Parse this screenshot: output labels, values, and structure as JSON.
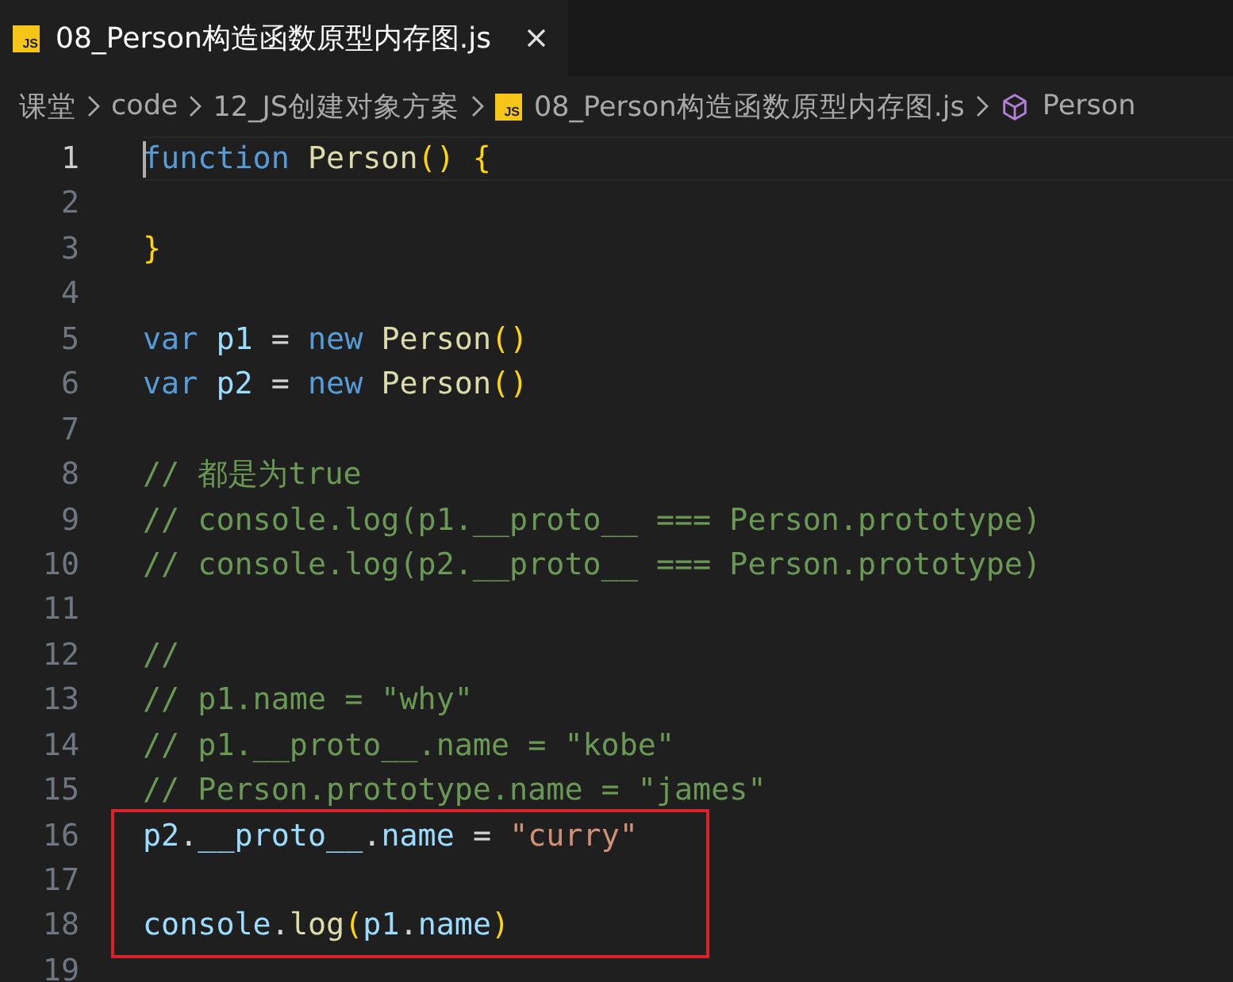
{
  "tabs": [
    {
      "label": "08_Person构造函数原型内存图.js",
      "icon_text": "JS",
      "selected": true
    }
  ],
  "breadcrumbs": [
    {
      "label": "课堂",
      "kind": "folder"
    },
    {
      "label": "code",
      "kind": "folder"
    },
    {
      "label": "12_JS创建对象方案",
      "kind": "folder"
    },
    {
      "label": "08_Person构造函数原型内存图.js",
      "kind": "file",
      "icon_text": "JS"
    },
    {
      "label": "Person",
      "kind": "symbol"
    }
  ],
  "lines": [
    {
      "number": "1",
      "current": true,
      "highlighted": false,
      "tokens": [
        {
          "text": "function ",
          "kind": "keyword"
        },
        {
          "text": "Person",
          "kind": "function"
        },
        {
          "text": "() {",
          "kind": "bracket"
        }
      ]
    },
    {
      "number": "2",
      "current": false,
      "highlighted": false
    },
    {
      "number": "3",
      "current": false,
      "highlighted": false,
      "tokens": [
        {
          "text": "}",
          "kind": "bracket"
        }
      ]
    },
    {
      "number": "4",
      "current": false,
      "highlighted": false
    },
    {
      "number": "5",
      "current": false,
      "highlighted": false,
      "tokens": [
        {
          "text": "var ",
          "kind": "keyword"
        },
        {
          "text": "p1",
          "kind": "variable"
        },
        {
          "text": " = ",
          "kind": "plain"
        },
        {
          "text": "new ",
          "kind": "keyword"
        },
        {
          "text": "Person",
          "kind": "function"
        },
        {
          "text": "()",
          "kind": "bracket"
        }
      ]
    },
    {
      "number": "6",
      "current": false,
      "highlighted": false,
      "tokens": [
        {
          "text": "var ",
          "kind": "keyword"
        },
        {
          "text": "p2",
          "kind": "variable"
        },
        {
          "text": " = ",
          "kind": "plain"
        },
        {
          "text": "new ",
          "kind": "keyword"
        },
        {
          "text": "Person",
          "kind": "function"
        },
        {
          "text": "()",
          "kind": "bracket"
        }
      ]
    },
    {
      "number": "7",
      "current": false,
      "highlighted": false
    },
    {
      "number": "8",
      "current": false,
      "highlighted": false,
      "tokens": [
        {
          "text": "// 都是为true",
          "kind": "comment"
        }
      ]
    },
    {
      "number": "9",
      "current": false,
      "highlighted": false,
      "tokens": [
        {
          "text": "// console.log(p1.__proto__ === Person.prototype)",
          "kind": "comment"
        }
      ]
    },
    {
      "number": "10",
      "current": false,
      "highlighted": false,
      "tokens": [
        {
          "text": "// console.log(p2.__proto__ === Person.prototype)",
          "kind": "comment"
        }
      ]
    },
    {
      "number": "11",
      "current": false,
      "highlighted": false
    },
    {
      "number": "12",
      "current": false,
      "highlighted": false,
      "tokens": [
        {
          "text": "//",
          "kind": "comment"
        }
      ]
    },
    {
      "number": "13",
      "current": false,
      "highlighted": false,
      "tokens": [
        {
          "text": "// p1.name = \"why\"",
          "kind": "comment"
        }
      ]
    },
    {
      "number": "14",
      "current": false,
      "highlighted": false,
      "tokens": [
        {
          "text": "// p1.__proto__.name = \"kobe\"",
          "kind": "comment"
        }
      ]
    },
    {
      "number": "15",
      "current": false,
      "highlighted": false,
      "tokens": [
        {
          "text": "// Person.prototype.name = \"james\"",
          "kind": "comment"
        }
      ]
    },
    {
      "number": "16",
      "current": false,
      "highlighted": true,
      "tokens": [
        {
          "text": "p2",
          "kind": "variable"
        },
        {
          "text": ".",
          "kind": "plain"
        },
        {
          "text": "__proto__",
          "kind": "variable"
        },
        {
          "text": ".",
          "kind": "plain"
        },
        {
          "text": "name",
          "kind": "variable"
        },
        {
          "text": " = ",
          "kind": "plain"
        },
        {
          "text": "\"curry\"",
          "kind": "string"
        }
      ]
    },
    {
      "number": "17",
      "current": false,
      "highlighted": true
    },
    {
      "number": "18",
      "current": false,
      "highlighted": true,
      "tokens": [
        {
          "text": "console",
          "kind": "variable"
        },
        {
          "text": ".",
          "kind": "plain"
        },
        {
          "text": "log",
          "kind": "function"
        },
        {
          "text": "(",
          "kind": "bracket"
        },
        {
          "text": "p1",
          "kind": "variable"
        },
        {
          "text": ".",
          "kind": "plain"
        },
        {
          "text": "name",
          "kind": "variable"
        },
        {
          "text": ")",
          "kind": "bracket"
        }
      ]
    },
    {
      "number": "19",
      "current": false,
      "highlighted": false
    }
  ]
}
